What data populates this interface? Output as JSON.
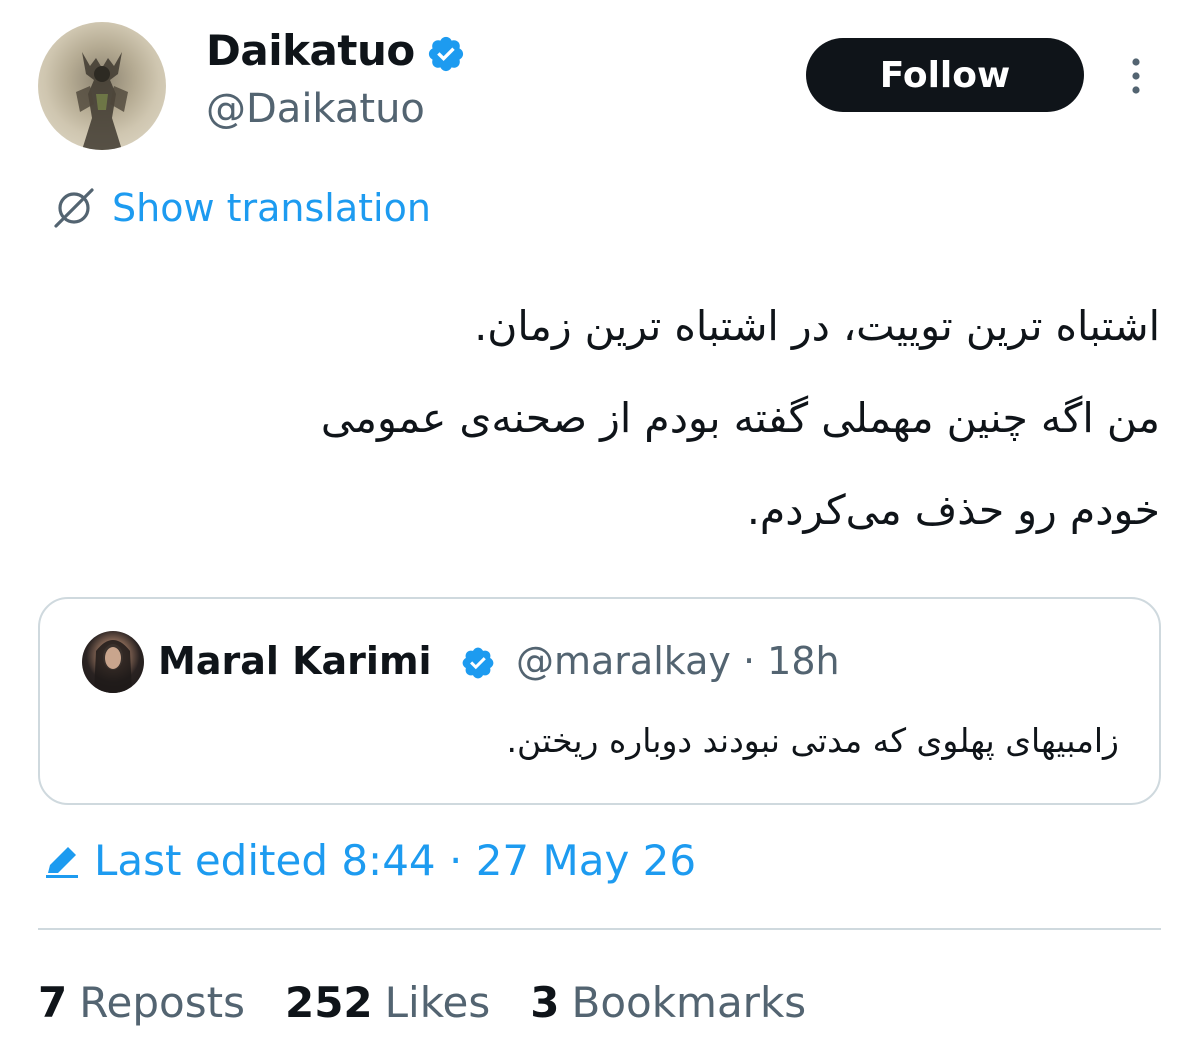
{
  "author": {
    "display_name": "Daikatuo",
    "handle": "@Daikatuo",
    "verified": true
  },
  "actions": {
    "follow_label": "Follow"
  },
  "translation": {
    "label": "Show translation"
  },
  "tweet": {
    "lines": [
      "اشتباه ترین توییت، در اشتباه ترین زمان.",
      "من اگه چنین مهملی گفته بودم از صحنه‌ی عمومی",
      "خودم رو حذف می‌کردم."
    ]
  },
  "quote": {
    "name": "Maral Karimi",
    "handle": "@maralkay",
    "time": "· 18h",
    "verified": true,
    "text": "زامبیهای پهلوی که مدتی نبودند دوباره ریختن."
  },
  "edit_info": {
    "label": "Last edited 8:44 · 27 May 26"
  },
  "stats": {
    "reposts_count": "7",
    "reposts_label": "Reposts",
    "likes_count": "252",
    "likes_label": "Likes",
    "bookmarks_count": "3",
    "bookmarks_label": "Bookmarks"
  },
  "colors": {
    "accent": "#1d9bf0",
    "text": "#0f1419",
    "secondary": "#536471",
    "border": "#cfd9de",
    "button": "#0f1419"
  },
  "icons": [
    "verified-badge-icon",
    "more-options-icon",
    "translate-icon",
    "edit-pencil-icon"
  ]
}
